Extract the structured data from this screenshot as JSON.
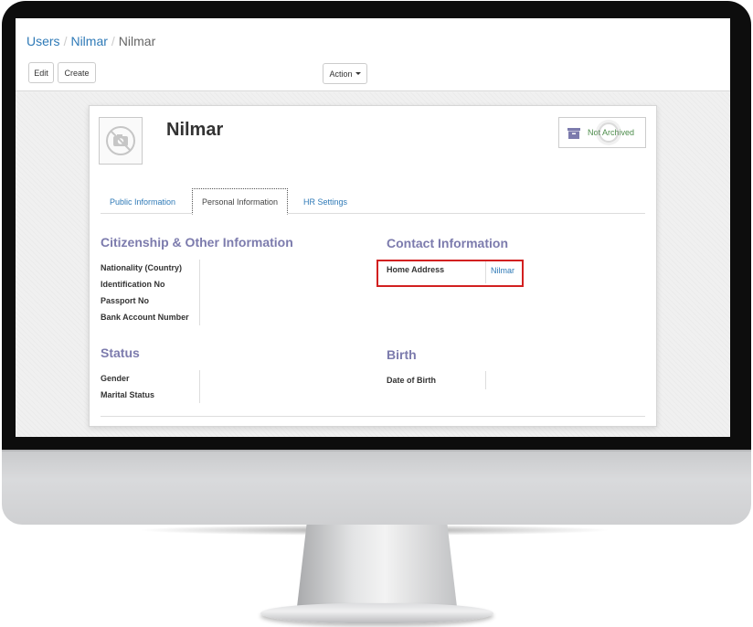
{
  "breadcrumb": {
    "items": [
      "Users",
      "Nilmar"
    ],
    "current": "Nilmar",
    "separator": "/"
  },
  "toolbar": {
    "edit_label": "Edit",
    "create_label": "Create",
    "action_label": "Action"
  },
  "employee": {
    "name": "Nilmar",
    "archive_label": "Not Archived"
  },
  "tabs": [
    {
      "label": "Public Information"
    },
    {
      "label": "Personal Information"
    },
    {
      "label": "HR Settings"
    }
  ],
  "citizenship": {
    "title": "Citizenship & Other Information",
    "fields": [
      "Nationality (Country)",
      "Identification No",
      "Passport No",
      "Bank Account Number"
    ]
  },
  "contact": {
    "title": "Contact Information",
    "home_address_label": "Home Address",
    "home_address_value": "Nilmar"
  },
  "status": {
    "title": "Status",
    "fields": [
      "Gender",
      "Marital Status"
    ]
  },
  "birth": {
    "title": "Birth",
    "dob_label": "Date of Birth"
  },
  "colors": {
    "link": "#2f7ab7",
    "section_title": "#7c7bad",
    "archived_green": "#4c8c4a",
    "highlight_red": "#d22020",
    "bezel": "#0d0d0d"
  }
}
